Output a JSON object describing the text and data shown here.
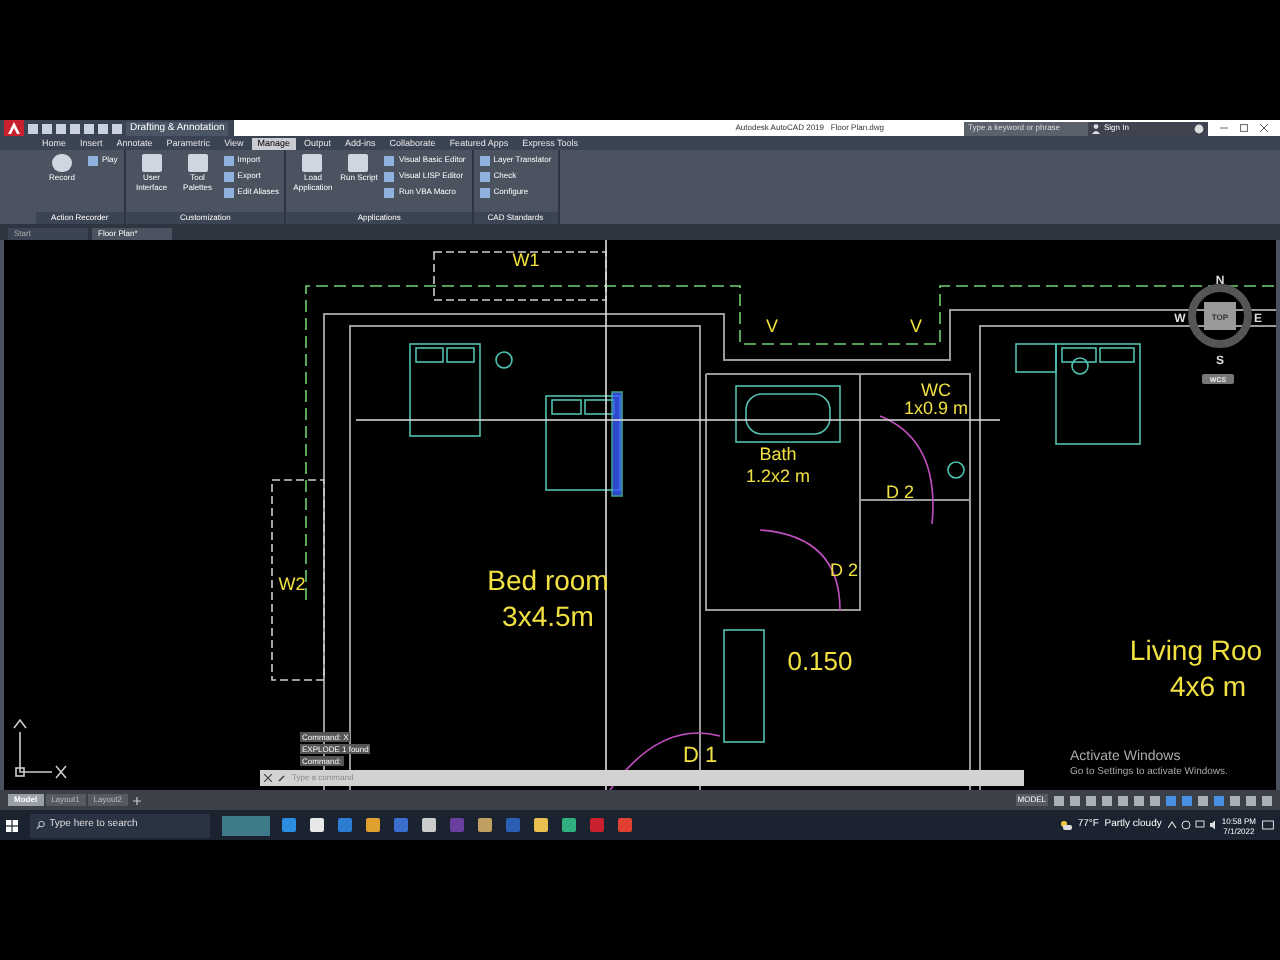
{
  "title_bar": {
    "workspace": "Drafting & Annotation",
    "title": "Autodesk AutoCAD 2019   Floor Plan.dwg",
    "search": {
      "placeholder": "Type a keyword or phrase"
    },
    "sign_in": "Sign In"
  },
  "ribbon_tabs": [
    {
      "label": "Home",
      "selected": false
    },
    {
      "label": "Insert",
      "selected": false
    },
    {
      "label": "Annotate",
      "selected": false
    },
    {
      "label": "Parametric",
      "selected": false
    },
    {
      "label": "View",
      "selected": false
    },
    {
      "label": "Manage",
      "selected": true
    },
    {
      "label": "Output",
      "selected": false
    },
    {
      "label": "Add-ins",
      "selected": false
    },
    {
      "label": "Collaborate",
      "selected": false
    },
    {
      "label": "Featured Apps",
      "selected": false
    },
    {
      "label": "Express Tools",
      "selected": false
    }
  ],
  "ribbon_panels": [
    {
      "title": "Action Recorder",
      "tools": [
        {
          "kind": "large",
          "label": "Record"
        },
        {
          "kind": "small",
          "label": "Play"
        }
      ]
    },
    {
      "title": "Customization",
      "tools": [
        {
          "kind": "large",
          "label": "User Interface"
        },
        {
          "kind": "large",
          "label": "Tool Palettes"
        },
        {
          "kind": "small",
          "label": "Import"
        },
        {
          "kind": "small",
          "label": "Export"
        },
        {
          "kind": "small",
          "label": "Edit Aliases"
        }
      ]
    },
    {
      "title": "Applications",
      "tools": [
        {
          "kind": "large",
          "label": "Load Application"
        },
        {
          "kind": "large",
          "label": "Run Script"
        },
        {
          "kind": "small",
          "label": "Visual Basic Editor"
        },
        {
          "kind": "small",
          "label": "Visual LISP Editor"
        },
        {
          "kind": "small",
          "label": "Run VBA Macro"
        }
      ]
    },
    {
      "title": "CAD Standards",
      "tools": [
        {
          "kind": "small",
          "label": "Layer Translator"
        },
        {
          "kind": "small",
          "label": "Check"
        },
        {
          "kind": "small",
          "label": "Configure"
        }
      ]
    }
  ],
  "file_tabs": [
    {
      "label": "Start",
      "selected": false
    },
    {
      "label": "Floor Plan*",
      "selected": true
    }
  ],
  "drawing": {
    "labels": [
      "W1",
      "V",
      "V",
      "W2",
      "Bed room",
      "3x4.5m",
      "Bath",
      "1.2x2 m",
      "WC",
      "1x0.9 m",
      "D 2",
      "D 2",
      "0.150",
      "Living Roo",
      "4x6 m",
      "D 1"
    ]
  },
  "viewcube": {
    "north": "N",
    "south": "S",
    "east": "E",
    "west": "W",
    "face": "TOP",
    "ucs": "WCS"
  },
  "command_history": [
    "Command: X",
    "EXPLODE 1 found",
    "Command:"
  ],
  "command_input": {
    "placeholder": "Type a command"
  },
  "activation_notice": {
    "title": "Activate Windows",
    "text": "Go to Settings to activate Windows."
  },
  "layout_tabs": [
    {
      "label": "Model",
      "selected": true
    },
    {
      "label": "Layout1",
      "selected": false
    },
    {
      "label": "Layout2",
      "selected": false
    }
  ],
  "status_bar": {
    "space": "MODEL"
  },
  "taskbar": {
    "search": {
      "placeholder": "Type here to search"
    },
    "weather": "77°F  Partly cloudy",
    "time": "10:58 PM",
    "date": "7/1/2022"
  }
}
